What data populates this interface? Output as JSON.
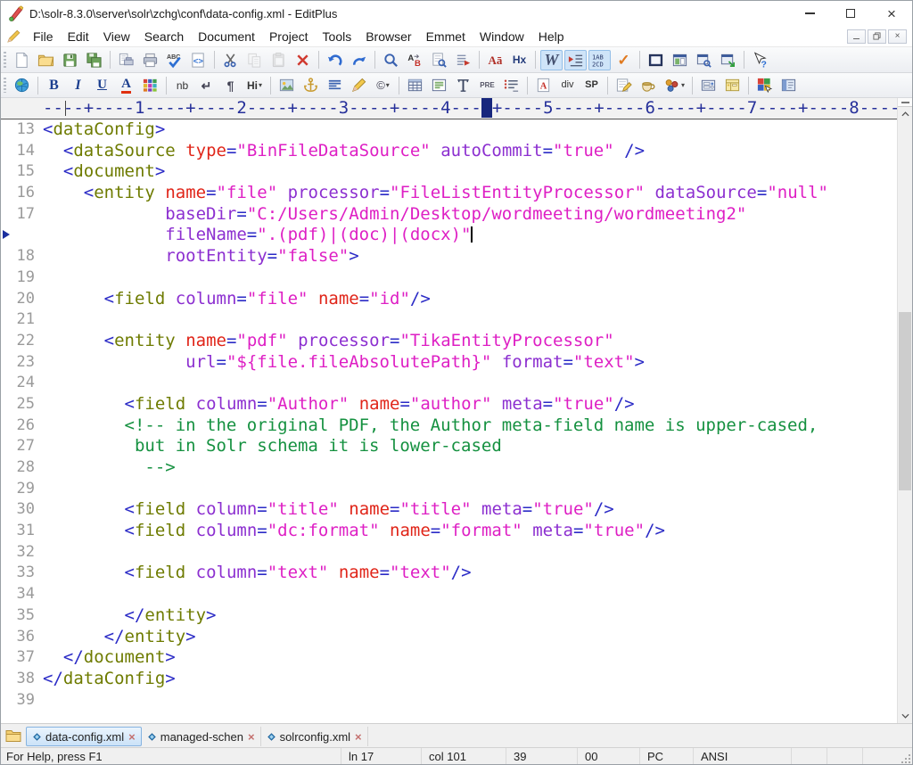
{
  "window": {
    "title": "D:\\solr-8.3.0\\server\\solr\\zchg\\conf\\data-config.xml - EditPlus",
    "controls": [
      "minimize",
      "maximize",
      "close"
    ],
    "mdi_controls": [
      "minimize-document",
      "restore-document",
      "close-document"
    ]
  },
  "menu": {
    "items": [
      "File",
      "Edit",
      "View",
      "Search",
      "Document",
      "Project",
      "Tools",
      "Browser",
      "Emmet",
      "Window",
      "Help"
    ]
  },
  "toolbar_main": {
    "items": [
      {
        "name": "new-file",
        "icon": "page"
      },
      {
        "name": "open-file",
        "icon": "folder"
      },
      {
        "name": "save",
        "icon": "floppy"
      },
      {
        "name": "save-all",
        "icon": "floppy2"
      },
      {
        "sep": true
      },
      {
        "name": "print-preview",
        "icon": "printprev"
      },
      {
        "name": "print",
        "icon": "printer"
      },
      {
        "name": "spell-check",
        "icon": "spell"
      },
      {
        "name": "view-in-browser",
        "icon": "codepage"
      },
      {
        "sep": true
      },
      {
        "name": "cut",
        "icon": "scissors"
      },
      {
        "name": "copy",
        "icon": "copy",
        "disabled": true
      },
      {
        "name": "paste",
        "icon": "paste",
        "disabled": true
      },
      {
        "name": "delete",
        "icon": "delx"
      },
      {
        "sep": true
      },
      {
        "name": "undo",
        "icon": "undo"
      },
      {
        "name": "redo",
        "icon": "redo"
      },
      {
        "sep": true
      },
      {
        "name": "find",
        "icon": "magnifier"
      },
      {
        "name": "replace",
        "icon": "replace"
      },
      {
        "name": "find-in-files",
        "icon": "findfiles"
      },
      {
        "name": "go-to-marker",
        "icon": "marker"
      },
      {
        "sep": true
      },
      {
        "name": "convert-case",
        "glyph": "Aā",
        "cls": "g-case"
      },
      {
        "name": "hex-view",
        "glyph": "Hx",
        "cls": "g-hx"
      },
      {
        "sep": true
      },
      {
        "name": "word-wrap",
        "glyph": "W",
        "cls": "g-w",
        "active": true
      },
      {
        "name": "auto-indent",
        "icon": "indent",
        "active": true
      },
      {
        "name": "line-numbers",
        "icon": "linenum",
        "active": true
      },
      {
        "name": "syntax-check",
        "glyph": "✓",
        "cls": "g-check"
      },
      {
        "sep": true
      },
      {
        "name": "full-screen",
        "icon": "win1"
      },
      {
        "name": "split-window",
        "icon": "win2"
      },
      {
        "name": "project-window",
        "icon": "win3"
      },
      {
        "name": "new-window",
        "icon": "win4"
      },
      {
        "sep": true
      },
      {
        "name": "context-help",
        "icon": "helparrow"
      }
    ]
  },
  "toolbar_html": {
    "items": [
      {
        "name": "browser",
        "icon": "globe"
      },
      {
        "sep": true
      },
      {
        "name": "bold",
        "glyph": "B",
        "cls": "g-b"
      },
      {
        "name": "italic",
        "glyph": "I",
        "cls": "g-i"
      },
      {
        "name": "underline",
        "glyph": "U",
        "cls": "g-u"
      },
      {
        "name": "font-color",
        "glyph": "A",
        "cls": "g-fc"
      },
      {
        "name": "color-picker",
        "icon": "palette"
      },
      {
        "sep": true
      },
      {
        "name": "non-breaking-space",
        "glyph": "nb",
        "cls": "g-nb"
      },
      {
        "name": "line-break",
        "glyph": "↵",
        "cls": "g-br"
      },
      {
        "name": "paragraph",
        "glyph": "¶",
        "cls": "g-para"
      },
      {
        "name": "heading",
        "glyph": "Hi",
        "cls": "g-hi",
        "dd": true
      },
      {
        "sep": true
      },
      {
        "name": "image",
        "icon": "image"
      },
      {
        "name": "anchor",
        "icon": "anchor"
      },
      {
        "name": "align",
        "icon": "align"
      },
      {
        "name": "edit-tag",
        "icon": "pencil"
      },
      {
        "name": "special-char",
        "glyph": "©",
        "cls": "g-copy",
        "dd": true
      },
      {
        "sep": true
      },
      {
        "name": "table",
        "icon": "table"
      },
      {
        "name": "div-block",
        "icon": "divblock"
      },
      {
        "name": "text-format",
        "icon": "textfmt"
      },
      {
        "name": "preformatted",
        "glyph": "PRE",
        "cls": "g-pre"
      },
      {
        "name": "list",
        "icon": "list"
      },
      {
        "sep": true
      },
      {
        "name": "named-anchor",
        "icon": "anchA"
      },
      {
        "name": "div",
        "glyph": "div",
        "cls": "g-div"
      },
      {
        "name": "span",
        "glyph": "SP",
        "cls": "g-sp"
      },
      {
        "sep": true
      },
      {
        "name": "script",
        "icon": "script"
      },
      {
        "name": "css",
        "icon": "cup"
      },
      {
        "name": "objects",
        "icon": "dots",
        "dd": true
      },
      {
        "sep": true
      },
      {
        "name": "form-fields",
        "icon": "form1"
      },
      {
        "name": "form-palette",
        "icon": "form2"
      },
      {
        "sep": true
      },
      {
        "name": "color-palette",
        "icon": "colorsel"
      },
      {
        "name": "panel",
        "icon": "panel"
      }
    ]
  },
  "ruler": {
    "before": "----+----1----+----2----+----3----+----4---",
    "after": "+----5----+----6----+----7----+----8----"
  },
  "editor": {
    "lines": [
      {
        "n": "13",
        "t": [
          [
            "p",
            "<"
          ],
          [
            "tag",
            "dataConfig"
          ],
          [
            "p",
            ">"
          ]
        ]
      },
      {
        "n": "14",
        "t": [
          [
            "pl",
            "  "
          ],
          [
            "p",
            "<"
          ],
          [
            "tag",
            "dataSource"
          ],
          [
            "pl",
            " "
          ],
          [
            "kattr",
            "type"
          ],
          [
            "p",
            "="
          ],
          [
            "val",
            "\"BinFileDataSource\""
          ],
          [
            "pl",
            " "
          ],
          [
            "attr",
            "autoCommit"
          ],
          [
            "p",
            "="
          ],
          [
            "val",
            "\"true\""
          ],
          [
            "pl",
            " "
          ],
          [
            "p",
            "/>"
          ]
        ]
      },
      {
        "n": "15",
        "t": [
          [
            "pl",
            "  "
          ],
          [
            "p",
            "<"
          ],
          [
            "tag",
            "document"
          ],
          [
            "p",
            ">"
          ]
        ]
      },
      {
        "n": "16",
        "t": [
          [
            "pl",
            "    "
          ],
          [
            "p",
            "<"
          ],
          [
            "tag",
            "entity"
          ],
          [
            "pl",
            " "
          ],
          [
            "kattr",
            "name"
          ],
          [
            "p",
            "="
          ],
          [
            "val",
            "\"file\""
          ],
          [
            "pl",
            " "
          ],
          [
            "attr",
            "processor"
          ],
          [
            "p",
            "="
          ],
          [
            "val",
            "\"FileListEntityProcessor\""
          ],
          [
            "pl",
            " "
          ],
          [
            "attr",
            "dataSource"
          ],
          [
            "p",
            "="
          ],
          [
            "val",
            "\"null\""
          ]
        ]
      },
      {
        "n": "17",
        "t": [
          [
            "pl",
            "            "
          ],
          [
            "attr",
            "baseDir"
          ],
          [
            "p",
            "="
          ],
          [
            "val",
            "\"C:/Users/Admin/Desktop/wordmeeting/wordmeeting2\""
          ]
        ]
      },
      {
        "n": "",
        "w": 1,
        "c": 1,
        "t": [
          [
            "pl",
            "            "
          ],
          [
            "attr",
            "fileName"
          ],
          [
            "p",
            "="
          ],
          [
            "val",
            "\".(pdf)|(doc)|(docx)\""
          ]
        ]
      },
      {
        "n": "18",
        "t": [
          [
            "pl",
            "            "
          ],
          [
            "attr",
            "rootEntity"
          ],
          [
            "p",
            "="
          ],
          [
            "val",
            "\"false\""
          ],
          [
            "p",
            ">"
          ]
        ]
      },
      {
        "n": "19",
        "t": []
      },
      {
        "n": "20",
        "t": [
          [
            "pl",
            "      "
          ],
          [
            "p",
            "<"
          ],
          [
            "tag",
            "field"
          ],
          [
            "pl",
            " "
          ],
          [
            "attr",
            "column"
          ],
          [
            "p",
            "="
          ],
          [
            "val",
            "\"file\""
          ],
          [
            "pl",
            " "
          ],
          [
            "kattr",
            "name"
          ],
          [
            "p",
            "="
          ],
          [
            "val",
            "\"id\""
          ],
          [
            "p",
            "/>"
          ]
        ]
      },
      {
        "n": "21",
        "t": []
      },
      {
        "n": "22",
        "t": [
          [
            "pl",
            "      "
          ],
          [
            "p",
            "<"
          ],
          [
            "tag",
            "entity"
          ],
          [
            "pl",
            " "
          ],
          [
            "kattr",
            "name"
          ],
          [
            "p",
            "="
          ],
          [
            "val",
            "\"pdf\""
          ],
          [
            "pl",
            " "
          ],
          [
            "attr",
            "processor"
          ],
          [
            "p",
            "="
          ],
          [
            "val",
            "\"TikaEntityProcessor\""
          ]
        ]
      },
      {
        "n": "23",
        "t": [
          [
            "pl",
            "              "
          ],
          [
            "attr",
            "url"
          ],
          [
            "p",
            "="
          ],
          [
            "val",
            "\"${file.fileAbsolutePath}\""
          ],
          [
            "pl",
            " "
          ],
          [
            "attr",
            "format"
          ],
          [
            "p",
            "="
          ],
          [
            "val",
            "\"text\""
          ],
          [
            "p",
            ">"
          ]
        ]
      },
      {
        "n": "24",
        "t": []
      },
      {
        "n": "25",
        "t": [
          [
            "pl",
            "        "
          ],
          [
            "p",
            "<"
          ],
          [
            "tag",
            "field"
          ],
          [
            "pl",
            " "
          ],
          [
            "attr",
            "column"
          ],
          [
            "p",
            "="
          ],
          [
            "val",
            "\"Author\""
          ],
          [
            "pl",
            " "
          ],
          [
            "kattr",
            "name"
          ],
          [
            "p",
            "="
          ],
          [
            "val",
            "\"author\""
          ],
          [
            "pl",
            " "
          ],
          [
            "attr",
            "meta"
          ],
          [
            "p",
            "="
          ],
          [
            "val",
            "\"true\""
          ],
          [
            "p",
            "/>"
          ]
        ]
      },
      {
        "n": "26",
        "t": [
          [
            "pl",
            "        "
          ],
          [
            "com",
            "<!-- in the original PDF, the Author meta-field name is upper-cased,"
          ]
        ]
      },
      {
        "n": "27",
        "t": [
          [
            "pl",
            "         "
          ],
          [
            "com",
            "but in Solr schema it is lower-cased"
          ]
        ]
      },
      {
        "n": "28",
        "t": [
          [
            "pl",
            "          "
          ],
          [
            "com",
            "-->"
          ]
        ]
      },
      {
        "n": "29",
        "t": []
      },
      {
        "n": "30",
        "t": [
          [
            "pl",
            "        "
          ],
          [
            "p",
            "<"
          ],
          [
            "tag",
            "field"
          ],
          [
            "pl",
            " "
          ],
          [
            "attr",
            "column"
          ],
          [
            "p",
            "="
          ],
          [
            "val",
            "\"title\""
          ],
          [
            "pl",
            " "
          ],
          [
            "kattr",
            "name"
          ],
          [
            "p",
            "="
          ],
          [
            "val",
            "\"title\""
          ],
          [
            "pl",
            " "
          ],
          [
            "attr",
            "meta"
          ],
          [
            "p",
            "="
          ],
          [
            "val",
            "\"true\""
          ],
          [
            "p",
            "/>"
          ]
        ]
      },
      {
        "n": "31",
        "t": [
          [
            "pl",
            "        "
          ],
          [
            "p",
            "<"
          ],
          [
            "tag",
            "field"
          ],
          [
            "pl",
            " "
          ],
          [
            "attr",
            "column"
          ],
          [
            "p",
            "="
          ],
          [
            "val",
            "\"dc:format\""
          ],
          [
            "pl",
            " "
          ],
          [
            "kattr",
            "name"
          ],
          [
            "p",
            "="
          ],
          [
            "val",
            "\"format\""
          ],
          [
            "pl",
            " "
          ],
          [
            "attr",
            "meta"
          ],
          [
            "p",
            "="
          ],
          [
            "val",
            "\"true\""
          ],
          [
            "p",
            "/>"
          ]
        ]
      },
      {
        "n": "32",
        "t": []
      },
      {
        "n": "33",
        "t": [
          [
            "pl",
            "        "
          ],
          [
            "p",
            "<"
          ],
          [
            "tag",
            "field"
          ],
          [
            "pl",
            " "
          ],
          [
            "attr",
            "column"
          ],
          [
            "p",
            "="
          ],
          [
            "val",
            "\"text\""
          ],
          [
            "pl",
            " "
          ],
          [
            "kattr",
            "name"
          ],
          [
            "p",
            "="
          ],
          [
            "val",
            "\"text\""
          ],
          [
            "p",
            "/>"
          ]
        ]
      },
      {
        "n": "34",
        "t": []
      },
      {
        "n": "35",
        "t": [
          [
            "pl",
            "        "
          ],
          [
            "p",
            "</"
          ],
          [
            "tag",
            "entity"
          ],
          [
            "p",
            ">"
          ]
        ]
      },
      {
        "n": "36",
        "t": [
          [
            "pl",
            "      "
          ],
          [
            "p",
            "</"
          ],
          [
            "tag",
            "entity"
          ],
          [
            "p",
            ">"
          ]
        ]
      },
      {
        "n": "37",
        "t": [
          [
            "pl",
            "  "
          ],
          [
            "p",
            "</"
          ],
          [
            "tag",
            "document"
          ],
          [
            "p",
            ">"
          ]
        ]
      },
      {
        "n": "38",
        "t": [
          [
            "p",
            "</"
          ],
          [
            "tag",
            "dataConfig"
          ],
          [
            "p",
            ">"
          ]
        ]
      },
      {
        "n": "39",
        "t": []
      }
    ]
  },
  "tabs": {
    "items": [
      {
        "name": "data-config",
        "label": "data-config.xml",
        "active": true
      },
      {
        "name": "managed-schema",
        "label": "managed-schen",
        "active": false
      },
      {
        "name": "solrconfig",
        "label": "solrconfig.xml",
        "active": false
      }
    ]
  },
  "statusbar": {
    "help": "For Help, press F1",
    "cells": [
      {
        "name": "line-indicator",
        "text": "ln 17"
      },
      {
        "name": "column-indicator",
        "text": "col 101"
      },
      {
        "name": "total-lines",
        "text": "39"
      },
      {
        "name": "selection-indicator",
        "text": "00"
      },
      {
        "name": "file-format",
        "text": "PC"
      },
      {
        "name": "encoding",
        "text": "ANSI"
      },
      {
        "name": "extra-1",
        "text": ""
      },
      {
        "name": "extra-2",
        "text": ""
      },
      {
        "name": "extra-3",
        "text": ""
      }
    ]
  },
  "colors": {
    "tag": "#6e7b00",
    "attr": "#8c2fd0",
    "kattr": "#e02519",
    "val": "#de1fc4",
    "com": "#159140",
    "punct": "#2b2bc6",
    "lnum": "#9a9a9a",
    "marker": "#17277d",
    "active_tab_bg": "#cbe2f8"
  }
}
